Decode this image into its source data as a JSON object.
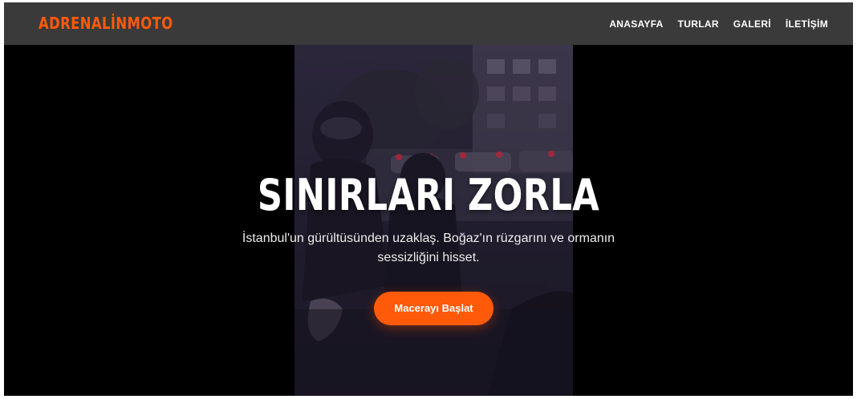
{
  "brand": {
    "logo_text": "ADRENALİNMOTO",
    "accent_color": "#ff5a0a"
  },
  "nav": {
    "items": [
      {
        "label": "ANASAYFA"
      },
      {
        "label": "TURLAR"
      },
      {
        "label": "GALERİ"
      },
      {
        "label": "İLETİŞİM"
      }
    ]
  },
  "hero": {
    "title": "SINIRLARI ZORLA",
    "subtitle_line1": "İstanbul'un gürültüsünden uzaklaş. Boğaz'ın rüzgarını ve ormanın",
    "subtitle_line2": "sessizliğini hisset.",
    "cta_label": "Macerayı Başlat"
  },
  "colors": {
    "navbar_bg": "#3a3a3a",
    "page_bg": "#000000",
    "text": "#ffffff"
  }
}
